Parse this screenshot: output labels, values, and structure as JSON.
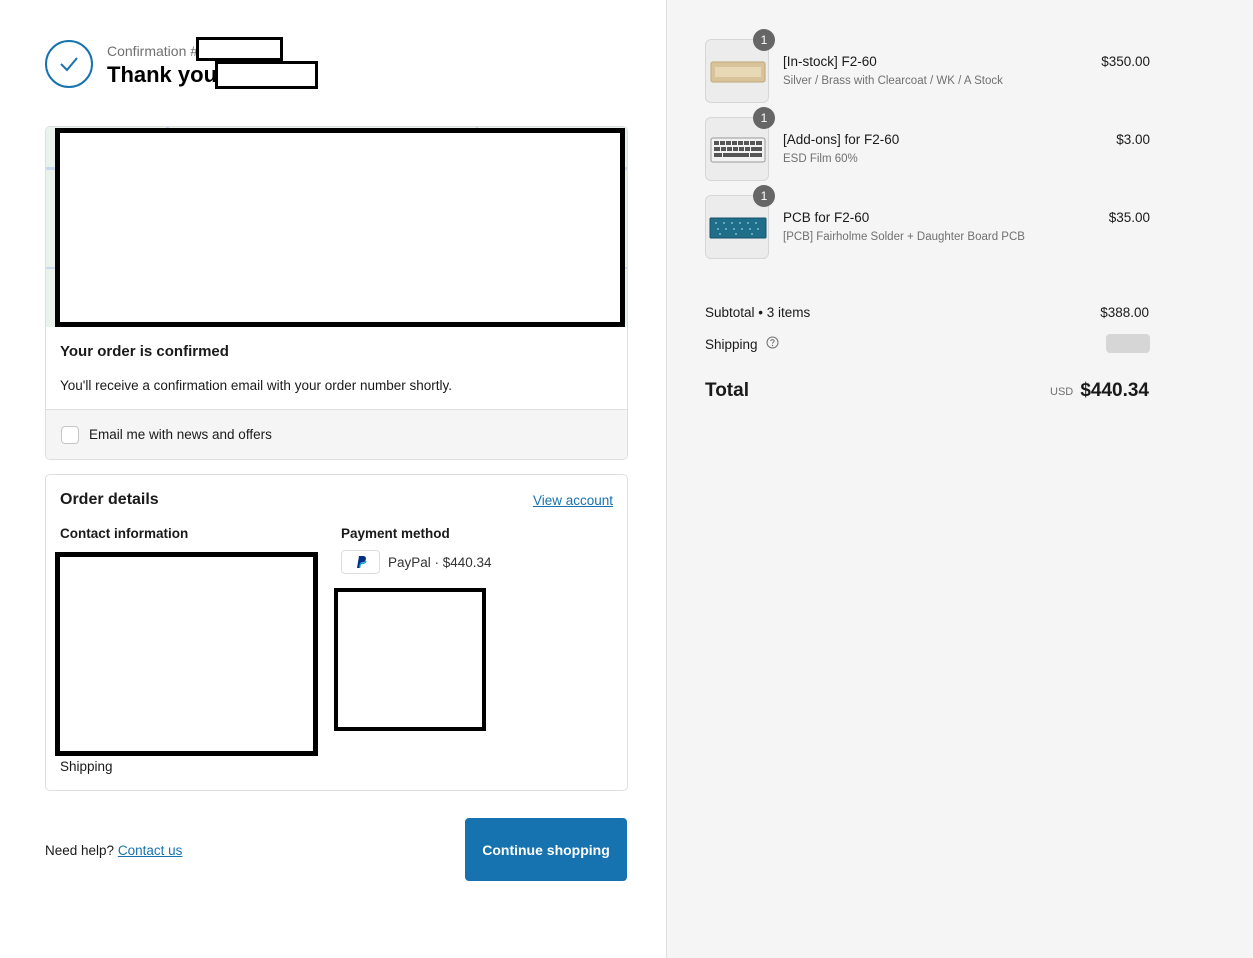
{
  "header": {
    "confirmation_label": "Confirmation #",
    "thank_you": "Thank you,"
  },
  "confirmation_card": {
    "title": "Your order is confirmed",
    "message": "You'll receive a confirmation email with your order number shortly.",
    "newsletter_label": "Email me with news and offers",
    "newsletter_checked": false
  },
  "order_details": {
    "title": "Order details",
    "view_account": "View account",
    "contact_label": "Contact information",
    "payment_label": "Payment method",
    "payment_text": "PayPal · $440.34",
    "shipping_label": "Shipping"
  },
  "footer": {
    "need_help": "Need help?",
    "contact_us": "Contact us",
    "continue_label": "Continue shopping"
  },
  "cart": {
    "items": [
      {
        "qty": "1",
        "name": "[In-stock] F2-60",
        "variant": "Silver / Brass with Clearcoat / WK / A Stock",
        "price": "$350.00"
      },
      {
        "qty": "1",
        "name": "[Add-ons] for F2-60",
        "variant": "ESD Film 60%",
        "price": "$3.00"
      },
      {
        "qty": "1",
        "name": "PCB for F2-60",
        "variant": "[PCB] Fairholme Solder + Daughter Board PCB",
        "price": "$35.00"
      }
    ],
    "subtotal_label": "Subtotal • 3 items",
    "subtotal_value": "$388.00",
    "shipping_label": "Shipping",
    "total_label": "Total",
    "currency": "USD",
    "total_value": "$440.34"
  },
  "colors": {
    "accent": "#1773b0",
    "sidebar_bg": "#f5f5f5"
  },
  "icons": [
    "check-icon",
    "paypal-icon",
    "help-circle-icon"
  ]
}
